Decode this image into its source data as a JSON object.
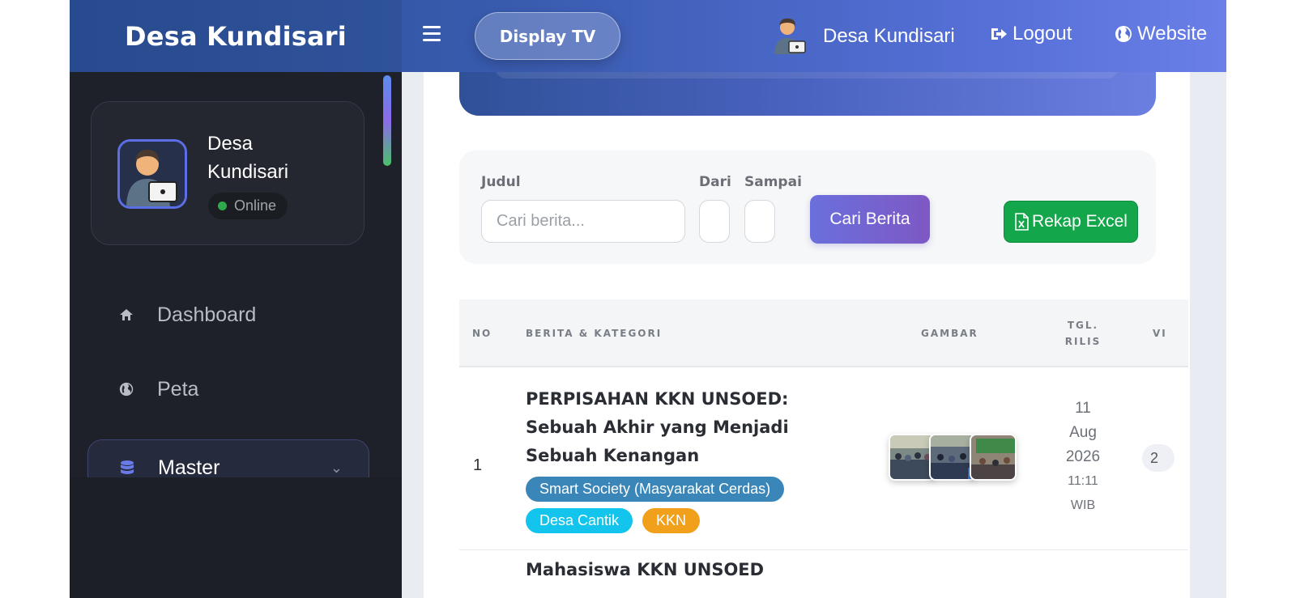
{
  "navbar": {
    "brand": "Desa Kundisari",
    "display_tv_label": "Display TV",
    "user_name": "Desa Kundisari",
    "logout_label": "Logout",
    "website_label": "Website"
  },
  "sidebar": {
    "profile": {
      "name": "Desa Kundisari",
      "status": "Online"
    },
    "items": [
      {
        "label": "Dashboard",
        "icon": "home-icon"
      },
      {
        "label": "Peta",
        "icon": "globe-icon"
      },
      {
        "label": "Master",
        "icon": "database-icon",
        "active": true
      }
    ]
  },
  "filter": {
    "judul_label": "Judul",
    "judul_placeholder": "Cari berita...",
    "dari_label": "Dari",
    "sampai_label": "Sampai",
    "search_button": "Cari Berita",
    "excel_button": "Rekap Excel"
  },
  "table": {
    "headers": [
      "NO",
      "BERITA & KATEGORI",
      "GAMBAR",
      "TGL. RILIS",
      "VI"
    ],
    "rows": [
      {
        "no": "1",
        "title": "PERPISAHAN KKN UNSOED: Sebuah Akhir yang Menjadi Sebuah Kenangan",
        "tags": [
          {
            "label": "Smart Society (Masyarakat Cerdas)",
            "color": "#3a86b8"
          },
          {
            "label": "Desa Cantik",
            "color": "#13c4ec"
          },
          {
            "label": "KKN",
            "color": "#f0a01a"
          }
        ],
        "date_day": "11",
        "date_month": "Aug",
        "date_year": "2026",
        "time": "11:11",
        "tz": "WIB",
        "views": "2"
      },
      {
        "title": "Mahasiswa KKN UNSOED"
      }
    ]
  },
  "colors": {
    "accent": "#5b6ee6",
    "sidebar_bg": "#1c1f26",
    "excel_green": "#13a64a"
  }
}
